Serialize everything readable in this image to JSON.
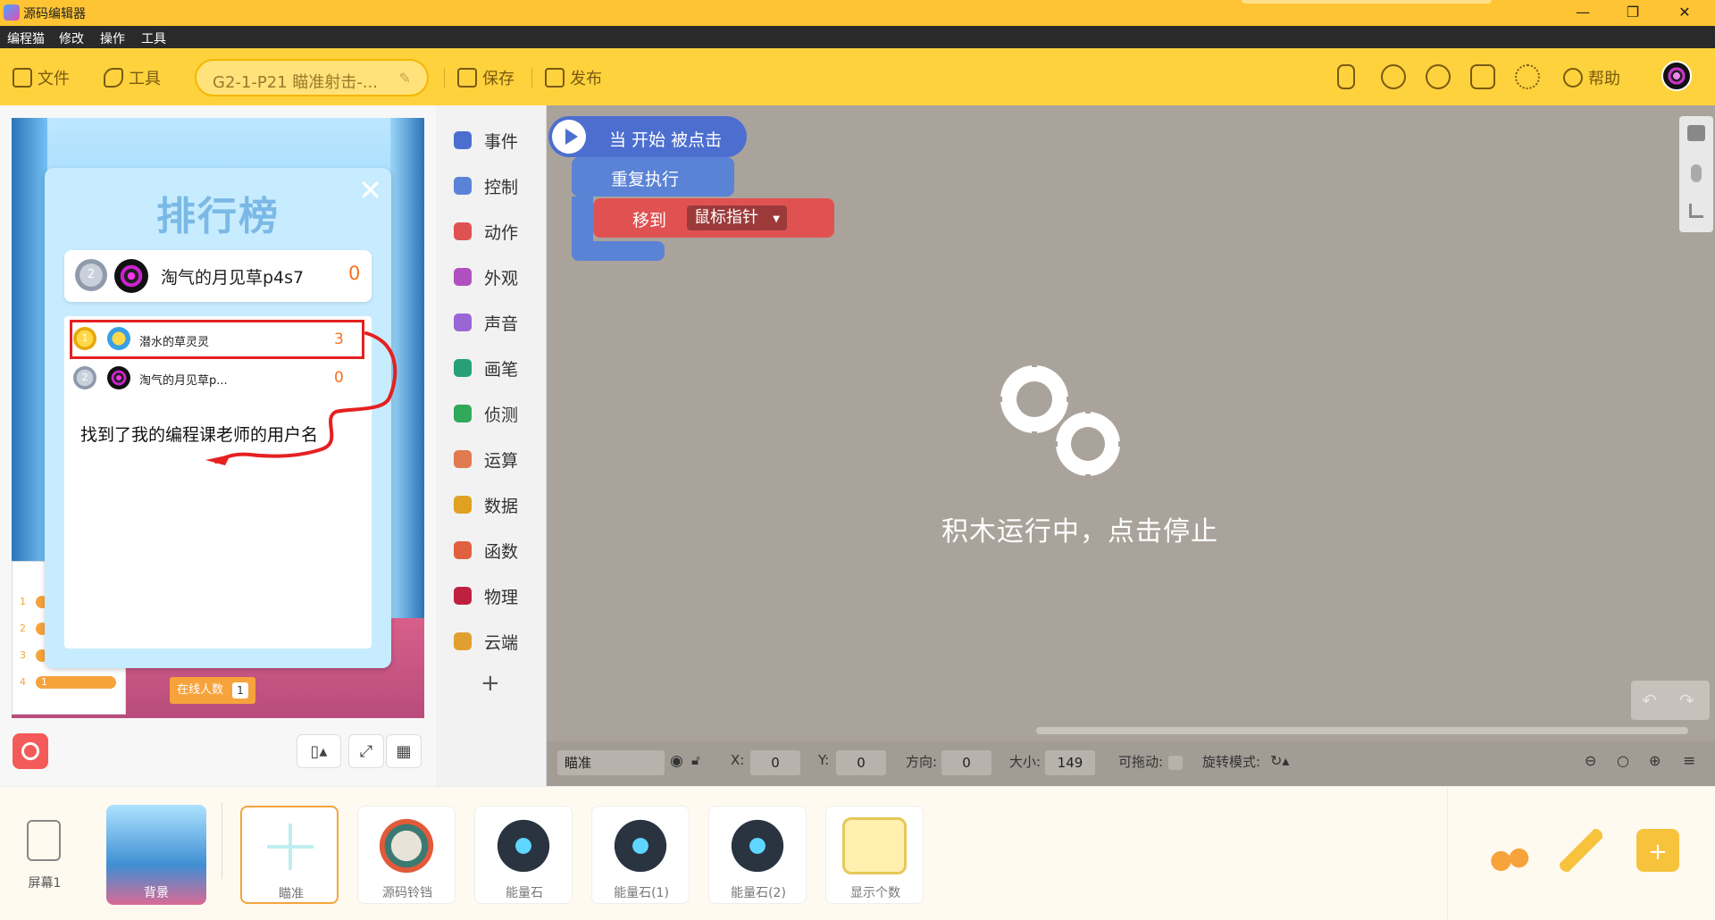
{
  "window": {
    "title": "源码编辑器",
    "minimize": "—",
    "restore": "❐",
    "close": "✕"
  },
  "menu": [
    "编程猫",
    "修改",
    "操作",
    "工具"
  ],
  "toolbar": {
    "file": "文件",
    "tools": "工具",
    "project_name": "G2-1-P21 瞄准射击-...",
    "save": "保存",
    "publish": "发布",
    "help": "帮助"
  },
  "leaderboard": {
    "title": "排行榜",
    "close": "✕",
    "me": {
      "rank": "2",
      "name": "淘气的月见草p4s7",
      "score": "0"
    },
    "rows": [
      {
        "rank": "1",
        "name": "潜水的草灵灵",
        "score": "3"
      },
      {
        "rank": "2",
        "name": "淘气的月见草p...",
        "score": "0"
      }
    ],
    "note": "找到了我的编程课老师的用户名"
  },
  "stage": {
    "online_label": "在线人数",
    "online_count": "1",
    "mini_ranks": [
      "1",
      "2",
      "3",
      "4"
    ],
    "mini_first": "1"
  },
  "categories": [
    "事件",
    "控制",
    "动作",
    "外观",
    "声音",
    "画笔",
    "侦测",
    "运算",
    "数据",
    "函数",
    "物理",
    "云端"
  ],
  "category_colors": [
    "#4c6fcf",
    "#5a83d6",
    "#e05252",
    "#b050c0",
    "#9966d6",
    "#27a07a",
    "#32a85a",
    "#e07a50",
    "#e0a020",
    "#e06040",
    "#c02040",
    "#e0a030"
  ],
  "blocks": {
    "hat": "当 开始 被点击",
    "repeat": "重复执行",
    "move_to": "移到",
    "move_target": "鼠标指针"
  },
  "running_text": "积木运行中，点击停止",
  "status": {
    "sprite": "瞄准",
    "x_label": "X:",
    "x": "0",
    "y_label": "Y:",
    "y": "0",
    "dir_label": "方向:",
    "dir": "0",
    "size_label": "大小:",
    "size": "149",
    "drag_label": "可拖动:",
    "rotate_label": "旋转模式:"
  },
  "bottom": {
    "screen": "屏幕1",
    "sprites": [
      "背景",
      "瞄准",
      "源码铃铛",
      "能量石",
      "能量石(1)",
      "能量石(2)",
      "显示个数"
    ]
  }
}
